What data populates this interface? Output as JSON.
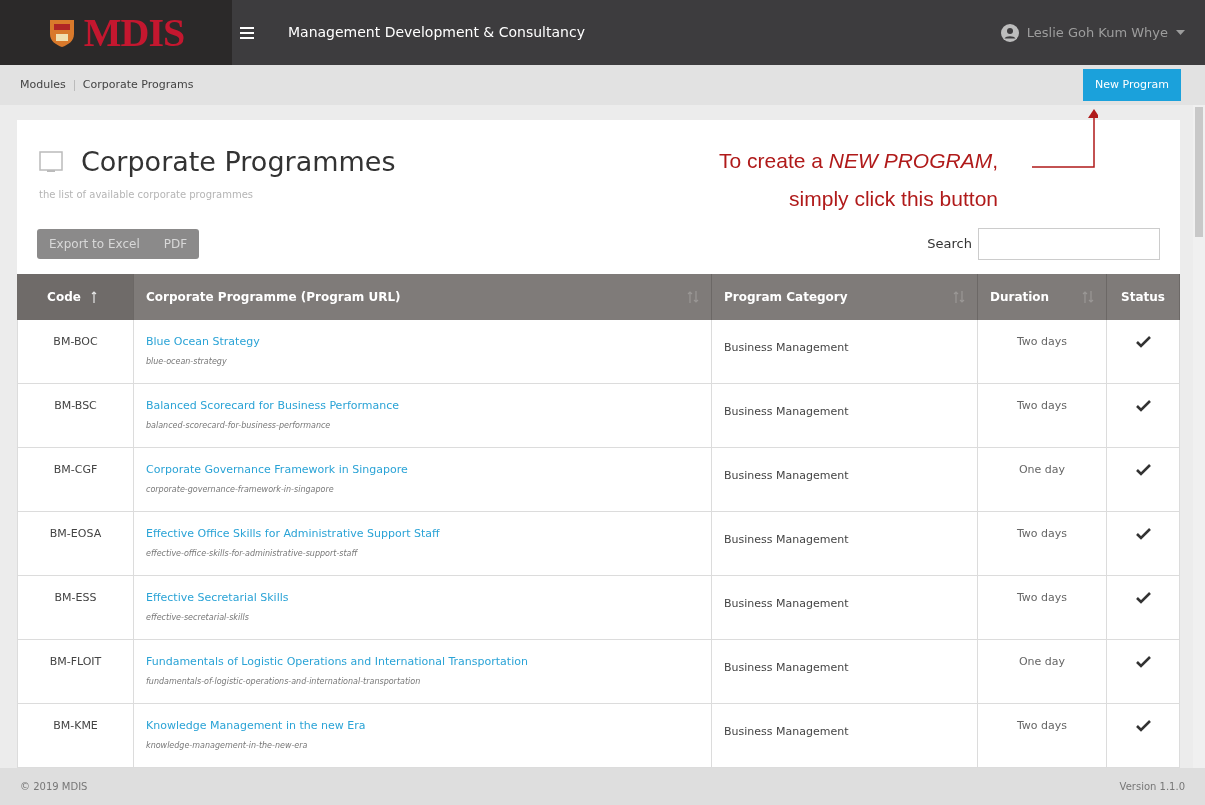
{
  "header": {
    "logo_text": "MDIS",
    "title": "Management Development & Consultancy",
    "user": "Leslie Goh Kum Whye"
  },
  "breadcrumb": [
    "Modules",
    "Corporate Programs"
  ],
  "new_button": "New Program",
  "annotation": "To create a *NEW PROGRAM*,\nsimply click this button",
  "page": {
    "title": "Corporate Programmes",
    "subtitle": "the list of available corporate programmes"
  },
  "export_buttons": [
    "Export to Excel",
    "PDF"
  ],
  "search": {
    "label": "Search"
  },
  "table": {
    "columns": [
      {
        "label": "Code",
        "sortable": true,
        "sorted": true
      },
      {
        "label": "Corporate Programme (Program URL)",
        "sortable": true,
        "sorted": false
      },
      {
        "label": "Program Category",
        "sortable": true,
        "sorted": false
      },
      {
        "label": "Duration",
        "sortable": true,
        "sorted": false
      },
      {
        "label": "Status",
        "sortable": false,
        "sorted": false
      }
    ],
    "rows": [
      {
        "code": "BM-BOC",
        "title": "Blue Ocean Strategy",
        "slug": "blue-ocean-strategy",
        "category": "Business Management",
        "duration": "Two days",
        "active": true
      },
      {
        "code": "BM-BSC",
        "title": "Balanced Scorecard for Business Performance",
        "slug": "balanced-scorecard-for-business-performance",
        "category": "Business Management",
        "duration": "Two days",
        "active": true
      },
      {
        "code": "BM-CGF",
        "title": "Corporate Governance Framework in Singapore",
        "slug": "corporate-governance-framework-in-singapore",
        "category": "Business Management",
        "duration": "One day",
        "active": true
      },
      {
        "code": "BM-EOSA",
        "title": "Effective Office Skills for Administrative Support Staff",
        "slug": "effective-office-skills-for-administrative-support-staff",
        "category": "Business Management",
        "duration": "Two days",
        "active": true
      },
      {
        "code": "BM-ESS",
        "title": "Effective Secretarial Skills",
        "slug": "effective-secretarial-skills",
        "category": "Business Management",
        "duration": "Two days",
        "active": true
      },
      {
        "code": "BM-FLOIT",
        "title": "Fundamentals of Logistic Operations and International Transportation",
        "slug": "fundamentals-of-logistic-operations-and-international-transportation",
        "category": "Business Management",
        "duration": "One day",
        "active": true
      },
      {
        "code": "BM-KME",
        "title": "Knowledge Management in the new Era",
        "slug": "knowledge-management-in-the-new-era",
        "category": "Business Management",
        "duration": "Two days",
        "active": true
      }
    ]
  },
  "footer": {
    "copyright": "© 2019 MDIS",
    "version": "Version 1.1.0"
  }
}
